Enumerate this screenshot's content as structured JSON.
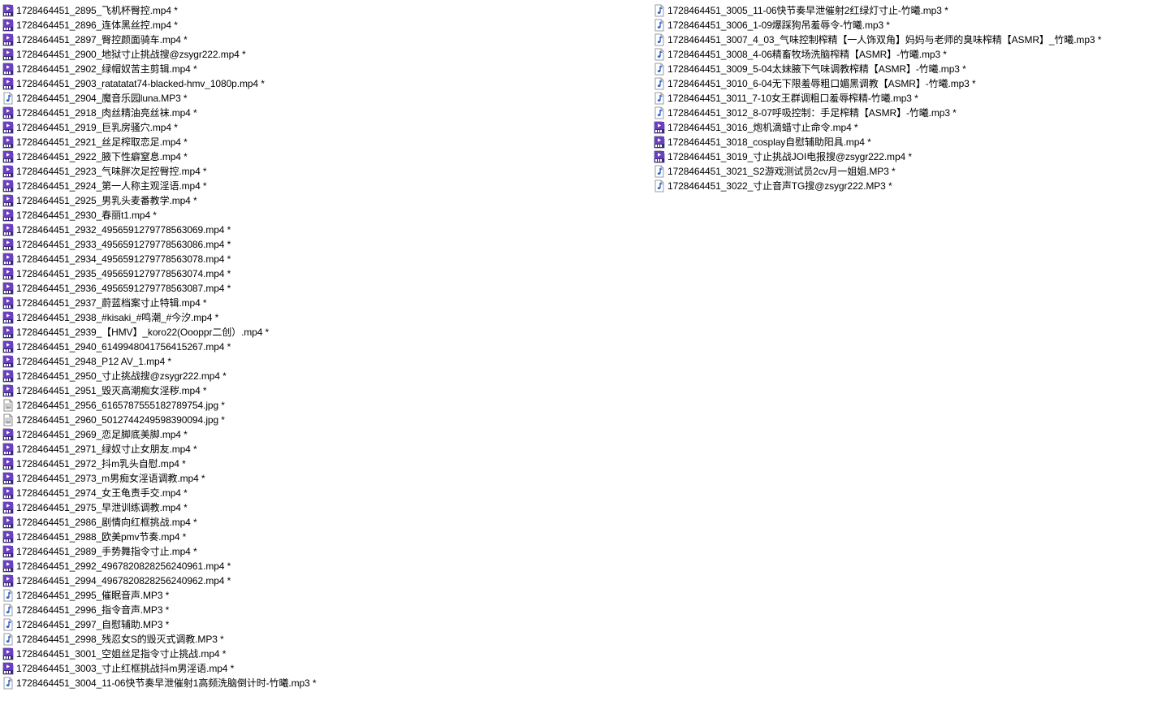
{
  "colors": {
    "video_icon": "#6a3fc0",
    "audio_icon": "#2a64c8",
    "image_icon": "#8a8a8a",
    "text": "#000000",
    "background": "#ffffff"
  },
  "columns": [
    {
      "items": [
        {
          "icon": "video-file-icon",
          "label": "1728464451_2895_飞机杯臀控.mp4 *"
        },
        {
          "icon": "video-file-icon",
          "label": "1728464451_2896_连体黑丝控.mp4 *"
        },
        {
          "icon": "video-file-icon",
          "label": "1728464451_2897_臀控颜面骑车.mp4 *"
        },
        {
          "icon": "video-file-icon",
          "label": "1728464451_2900_地狱寸止挑战搜@zsygr222.mp4 *"
        },
        {
          "icon": "video-file-icon",
          "label": "1728464451_2902_绿帽奴苦主剪辑.mp4 *"
        },
        {
          "icon": "video-file-icon",
          "label": "1728464451_2903_ratatatat74-blacked-hmv_1080p.mp4 *"
        },
        {
          "icon": "audio-file-icon",
          "label": "1728464451_2904_魔音乐园luna.MP3 *"
        },
        {
          "icon": "video-file-icon",
          "label": "1728464451_2918_肉丝精油亮丝袜.mp4 *"
        },
        {
          "icon": "video-file-icon",
          "label": "1728464451_2919_巨乳房骚穴.mp4 *"
        },
        {
          "icon": "video-file-icon",
          "label": "1728464451_2921_丝足榨取恋足.mp4 *"
        },
        {
          "icon": "video-file-icon",
          "label": "1728464451_2922_腋下性癖窒息.mp4 *"
        },
        {
          "icon": "video-file-icon",
          "label": "1728464451_2923_气味胖次足控臀控.mp4 *"
        },
        {
          "icon": "video-file-icon",
          "label": "1728464451_2924_第一人称主观淫语.mp4 *"
        },
        {
          "icon": "video-file-icon",
          "label": "1728464451_2925_男乳头麦番教学.mp4 *"
        },
        {
          "icon": "video-file-icon",
          "label": "1728464451_2930_春丽t1.mp4 *"
        },
        {
          "icon": "video-file-icon",
          "label": "1728464451_2932_4956591279778563069.mp4 *"
        },
        {
          "icon": "video-file-icon",
          "label": "1728464451_2933_4956591279778563086.mp4 *"
        },
        {
          "icon": "video-file-icon",
          "label": "1728464451_2934_4956591279778563078.mp4 *"
        },
        {
          "icon": "video-file-icon",
          "label": "1728464451_2935_4956591279778563074.mp4 *"
        },
        {
          "icon": "video-file-icon",
          "label": "1728464451_2936_4956591279778563087.mp4 *"
        },
        {
          "icon": "video-file-icon",
          "label": "1728464451_2937_蔚蓝档案寸止特辑.mp4 *"
        },
        {
          "icon": "video-file-icon",
          "label": "1728464451_2938_#kisaki_#鸣潮_#今汐.mp4 *"
        },
        {
          "icon": "video-file-icon",
          "label": "1728464451_2939_【HMV】_koro22(Oooppr二创）.mp4 *"
        },
        {
          "icon": "video-file-icon",
          "label": "1728464451_2940_6149948041756415267.mp4 *"
        },
        {
          "icon": "video-file-icon",
          "label": "1728464451_2948_P12 AV_1.mp4 *"
        },
        {
          "icon": "video-file-icon",
          "label": "1728464451_2950_寸止挑战搜@zsygr222.mp4 *"
        },
        {
          "icon": "video-file-icon",
          "label": "1728464451_2951_毁灭高潮痴女淫秽.mp4 *"
        },
        {
          "icon": "image-file-icon",
          "label": "1728464451_2956_6165787555182789754.jpg *"
        },
        {
          "icon": "image-file-icon",
          "label": "1728464451_2960_5012744249598390094.jpg *"
        },
        {
          "icon": "video-file-icon",
          "label": "1728464451_2969_恋足脚底美脚.mp4 *"
        },
        {
          "icon": "video-file-icon",
          "label": "1728464451_2971_绿奴寸止女朋友.mp4 *"
        },
        {
          "icon": "video-file-icon",
          "label": "1728464451_2972_抖m乳头自慰.mp4 *"
        },
        {
          "icon": "video-file-icon",
          "label": "1728464451_2973_m男痴女淫语调教.mp4 *"
        },
        {
          "icon": "video-file-icon",
          "label": "1728464451_2974_女王龟责手交.mp4 *"
        },
        {
          "icon": "video-file-icon",
          "label": "1728464451_2975_早泄训练调教.mp4 *"
        },
        {
          "icon": "video-file-icon",
          "label": "1728464451_2986_剧情向红框挑战.mp4 *"
        },
        {
          "icon": "video-file-icon",
          "label": "1728464451_2988_欧美pmv节奏.mp4 *"
        },
        {
          "icon": "video-file-icon",
          "label": "1728464451_2989_手势舞指令寸止.mp4 *"
        },
        {
          "icon": "video-file-icon",
          "label": "1728464451_2992_4967820828256240961.mp4 *"
        },
        {
          "icon": "video-file-icon",
          "label": "1728464451_2994_4967820828256240962.mp4 *"
        },
        {
          "icon": "audio-file-icon",
          "label": "1728464451_2995_催眠音声.MP3 *"
        },
        {
          "icon": "audio-file-icon",
          "label": "1728464451_2996_指令音声.MP3 *"
        },
        {
          "icon": "audio-file-icon",
          "label": "1728464451_2997_自慰辅助.MP3 *"
        },
        {
          "icon": "audio-file-icon",
          "label": "1728464451_2998_残忍女S的毁灭式调教.MP3 *"
        },
        {
          "icon": "video-file-icon",
          "label": "1728464451_3001_空姐丝足指令寸止挑战.mp4 *"
        },
        {
          "icon": "video-file-icon",
          "label": "1728464451_3003_寸止红框挑战抖m男淫语.mp4 *"
        },
        {
          "icon": "audio-file-icon",
          "label": "1728464451_3004_11-06快节奏早泄催射1高频洗脑倒计时-竹曦.mp3 *"
        }
      ]
    },
    {
      "items": [
        {
          "icon": "audio-file-icon",
          "label": "1728464451_3005_11-06快节奏早泄催射2红绿灯寸止-竹曦.mp3 *"
        },
        {
          "icon": "audio-file-icon",
          "label": "1728464451_3006_1-09爆踩狗吊羞辱令-竹曦.mp3 *"
        },
        {
          "icon": "audio-file-icon",
          "label": "1728464451_3007_4_03_气味控制榨精【一人饰双角】妈妈与老师的臭味榨精【ASMR】_竹曦.mp3 *"
        },
        {
          "icon": "audio-file-icon",
          "label": "1728464451_3008_4-06精畜牧场洗脑榨精【ASMR】-竹曦.mp3 *"
        },
        {
          "icon": "audio-file-icon",
          "label": "1728464451_3009_5-04太妹腋下气味调教榨精【ASMR】-竹曦.mp3 *"
        },
        {
          "icon": "audio-file-icon",
          "label": "1728464451_3010_6-04无下限羞辱粗口媚黑调教【ASMR】-竹曦.mp3 *"
        },
        {
          "icon": "audio-file-icon",
          "label": "1728464451_3011_7-10女王群调粗口羞辱榨精-竹曦.mp3 *"
        },
        {
          "icon": "audio-file-icon",
          "label": "1728464451_3012_8-07呼吸控制：手足榨精【ASMR】-竹曦.mp3 *"
        },
        {
          "icon": "video-file-icon",
          "label": "1728464451_3016_炮机滴蜡寸止命令.mp4 *"
        },
        {
          "icon": "video-file-icon",
          "label": "1728464451_3018_cosplay自慰辅助阳具.mp4 *"
        },
        {
          "icon": "video-file-icon",
          "label": "1728464451_3019_寸止挑战JOI电报搜@zsygr222.mp4 *"
        },
        {
          "icon": "audio-file-icon",
          "label": "1728464451_3021_S2游戏测试员2cv月一姐姐.MP3 *"
        },
        {
          "icon": "audio-file-icon",
          "label": "1728464451_3022_寸止音声TG搜@zsygr222.MP3 *"
        }
      ]
    }
  ]
}
